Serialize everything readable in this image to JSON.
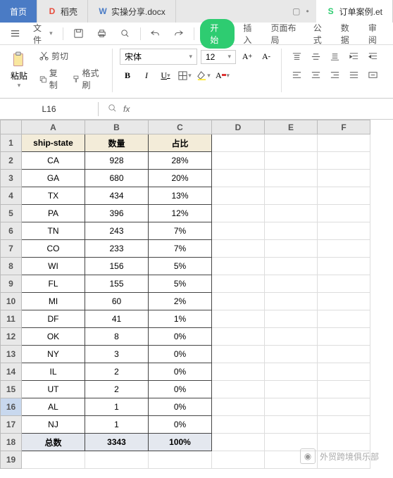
{
  "tabs": [
    {
      "label": "首页",
      "type": "blue"
    },
    {
      "label": "稻壳",
      "type": "red",
      "iconChar": "D"
    },
    {
      "label": "实操分享.docx",
      "type": "doc",
      "iconChar": "W"
    },
    {
      "label": "订单案例.et",
      "type": "sheet",
      "iconChar": "S"
    }
  ],
  "menu": {
    "file": "文件",
    "start": "开始",
    "insert": "插入",
    "layout": "页面布局",
    "formula": "公式",
    "data": "数据",
    "review": "审阅"
  },
  "toolbar": {
    "paste": "粘贴",
    "cut": "剪切",
    "copy": "复制",
    "formatBrush": "格式刷",
    "font": "宋体",
    "size": "12"
  },
  "namebox": "L16",
  "columns": [
    "A",
    "B",
    "C",
    "D",
    "E",
    "F"
  ],
  "headers": {
    "A": "ship-state",
    "B": "数量",
    "C": "占比"
  },
  "rows": [
    {
      "n": 2,
      "A": "CA",
      "B": "928",
      "C": "28%"
    },
    {
      "n": 3,
      "A": "GA",
      "B": "680",
      "C": "20%"
    },
    {
      "n": 4,
      "A": "TX",
      "B": "434",
      "C": "13%"
    },
    {
      "n": 5,
      "A": "PA",
      "B": "396",
      "C": "12%"
    },
    {
      "n": 6,
      "A": "TN",
      "B": "243",
      "C": "7%"
    },
    {
      "n": 7,
      "A": "CO",
      "B": "233",
      "C": "7%"
    },
    {
      "n": 8,
      "A": "WI",
      "B": "156",
      "C": "5%"
    },
    {
      "n": 9,
      "A": "FL",
      "B": "155",
      "C": "5%"
    },
    {
      "n": 10,
      "A": "MI",
      "B": "60",
      "C": "2%"
    },
    {
      "n": 11,
      "A": "DF",
      "B": "41",
      "C": "1%"
    },
    {
      "n": 12,
      "A": "OK",
      "B": "8",
      "C": "0%"
    },
    {
      "n": 13,
      "A": "NY",
      "B": "3",
      "C": "0%"
    },
    {
      "n": 14,
      "A": "IL",
      "B": "2",
      "C": "0%"
    },
    {
      "n": 15,
      "A": "UT",
      "B": "2",
      "C": "0%"
    },
    {
      "n": 16,
      "A": "AL",
      "B": "1",
      "C": "0%"
    },
    {
      "n": 17,
      "A": "NJ",
      "B": "1",
      "C": "0%"
    }
  ],
  "total": {
    "n": 18,
    "A": "总数",
    "B": "3343",
    "C": "100%"
  },
  "watermark": "外贸跨境俱乐部"
}
